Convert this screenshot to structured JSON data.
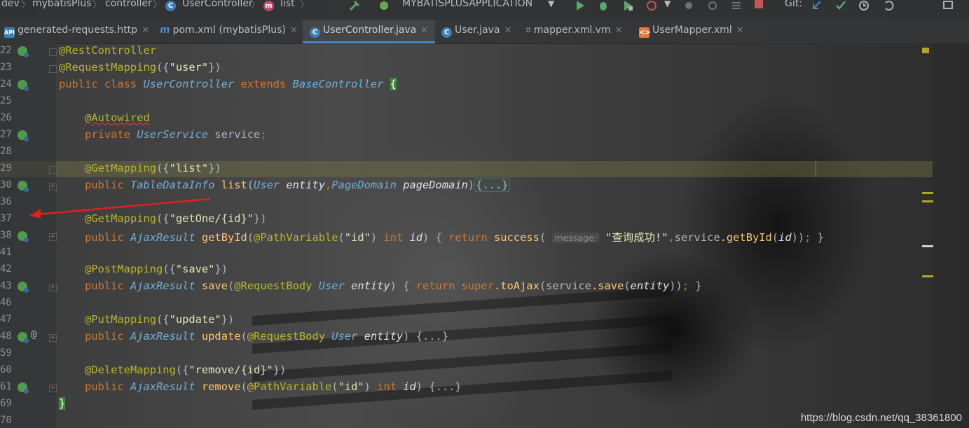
{
  "navbar": {
    "crumbs": [
      "dev",
      "mybatisPlus",
      "controller",
      "UserController",
      "list"
    ],
    "run_config": "MYBATISPLUSAPPLICATION",
    "git_label": "Git:"
  },
  "tabs": [
    {
      "label": "generated-requests.http",
      "icon": "api-icon"
    },
    {
      "label": "pom.xml (mybatisPlus)",
      "icon": "maven-icon"
    },
    {
      "label": "UserController.java",
      "icon": "class-icon",
      "active": true
    },
    {
      "label": "User.java",
      "icon": "class-icon"
    },
    {
      "label": "mapper.xml.vm",
      "icon": "template-icon"
    },
    {
      "label": "UserMapper.xml",
      "icon": "xml-icon"
    }
  ],
  "editor": {
    "line_numbers": [
      "22",
      "23",
      "24",
      "25",
      "26",
      "27",
      "28",
      "29",
      "30",
      "36",
      "37",
      "38",
      "41",
      "42",
      "43",
      "46",
      "47",
      "48",
      "59",
      "60",
      "61",
      "69",
      "70"
    ],
    "lines": {
      "l22": "@RestController",
      "l23_ann": "@RequestMapping",
      "l23_str": "\"user\"",
      "l24_kw": "public class ",
      "l24_cls": "UserController",
      "l24_ext": " extends ",
      "l24_base": "BaseController",
      "l26": "@Autowired",
      "l27_kw": "private ",
      "l27_cls": "UserService",
      "l27_var": " service",
      "l29_ann": "@GetMapping",
      "l29_str": "\"list\"",
      "l30_kw": "public ",
      "l30_cls": "TableDataInfo",
      "l30_fn": " list",
      "l30_p1t": "User",
      "l30_p1": " entity",
      "l30_p2t": "PageDomain",
      "l30_p2": " pageDomain",
      "l30_fold": "{...}",
      "l37_ann": "@GetMapping",
      "l37_str": "\"getOne/{id}\"",
      "l38_kw": "public ",
      "l38_cls": "AjaxResult",
      "l38_fn": " getById",
      "l38_pann": "@PathVariable",
      "l38_pstr": "\"id\"",
      "l38_int": " int",
      "l38_id": " id",
      "l38_ret": " return ",
      "l38_succ": "success",
      "l38_hint": "message:",
      "l38_msg": "\"查询成功!\"",
      "l38_svc": "service",
      "l38_call": ".getById",
      "l38_arg": "id",
      "l42_ann": "@PostMapping",
      "l42_str": "\"save\"",
      "l43_kw": "public ",
      "l43_cls": "AjaxResult",
      "l43_fn": " save",
      "l43_pann": "@RequestBody",
      "l43_pt": " User",
      "l43_p": " entity",
      "l43_ret": " return ",
      "l43_super": "super",
      "l43_call": ".toAjax",
      "l43_svc": "service",
      "l43_save": ".save",
      "l43_arg": "entity",
      "l47_ann": "@PutMapping",
      "l47_str": "\"update\"",
      "l48_kw": "public ",
      "l48_cls": "AjaxResult",
      "l48_fn": " update",
      "l48_pann": "@RequestBody",
      "l48_pt": " User",
      "l48_p": " entity",
      "l48_fold": " {...}",
      "l60_ann": "@DeleteMapping",
      "l60_str": "\"remove/{id}\"",
      "l61_kw": "public ",
      "l61_cls": "AjaxResult",
      "l61_fn": " remove",
      "l61_pann": "@PathVariable",
      "l61_pstr": "\"id\"",
      "l61_int": " int",
      "l61_id": " id",
      "l61_fold": " {...}",
      "l69": "}"
    }
  },
  "watermark": "https://blog.csdn.net/qq_38361800",
  "colors": {
    "keyword": "#cc7832",
    "annotation": "#bbb529",
    "class": "#6fb0d8",
    "string": "#e3e3b4",
    "accent": "#4a88c7"
  }
}
